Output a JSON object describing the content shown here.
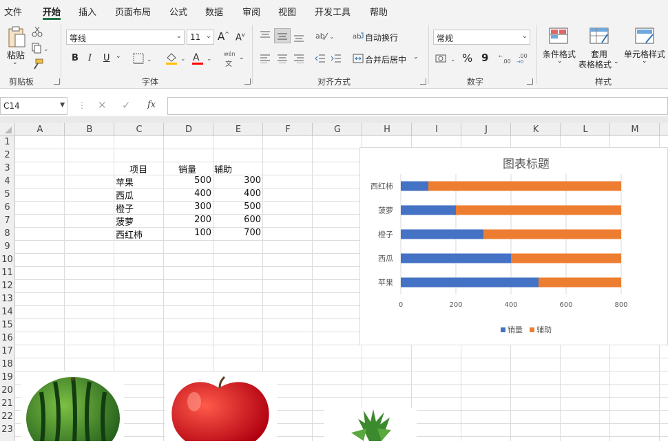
{
  "menu": {
    "items": [
      "文件",
      "开始",
      "插入",
      "页面布局",
      "公式",
      "数据",
      "审阅",
      "视图",
      "开发工具",
      "帮助"
    ]
  },
  "ribbon": {
    "clipboard": {
      "paste": "粘贴",
      "group": "剪贴板"
    },
    "font": {
      "name": "等线",
      "size": "11",
      "group": "字体",
      "bold": "B",
      "italic": "I",
      "underline": "U",
      "phonetic_top": "wén",
      "phonetic_bottom": "文"
    },
    "alignment": {
      "wrap": "自动换行",
      "merge": "合并后居中",
      "group": "对齐方式"
    },
    "number": {
      "format": "常规",
      "percent": "%",
      "comma": "9",
      "group": "数字"
    },
    "styles": {
      "conditional": "条件格式",
      "table_top": "套用",
      "table_bottom": "表格格式",
      "cell_styles": "单元格样式",
      "group": "样式"
    }
  },
  "formula_bar": {
    "name_box": "C14",
    "value": ""
  },
  "columns": [
    "A",
    "B",
    "C",
    "D",
    "E",
    "F",
    "G",
    "H",
    "I",
    "J",
    "K",
    "L",
    "M"
  ],
  "rows": [
    "1",
    "2",
    "3",
    "4",
    "5",
    "6",
    "7",
    "8",
    "9",
    "10",
    "11",
    "12",
    "13",
    "14",
    "15",
    "16",
    "17",
    "18",
    "19",
    "20",
    "21",
    "22",
    "23"
  ],
  "table": {
    "headers": [
      "项目",
      "销量",
      "辅助"
    ],
    "rows": [
      [
        "苹果",
        "500",
        "300"
      ],
      [
        "西瓜",
        "400",
        "400"
      ],
      [
        "橙子",
        "300",
        "500"
      ],
      [
        "菠萝",
        "200",
        "600"
      ],
      [
        "西红柿",
        "100",
        "700"
      ]
    ]
  },
  "chart_data": {
    "type": "bar",
    "stacked": true,
    "orientation": "horizontal",
    "title": "图表标题",
    "categories": [
      "西红柿",
      "菠萝",
      "橙子",
      "西瓜",
      "苹果"
    ],
    "series": [
      {
        "name": "销量",
        "values": [
          100,
          200,
          300,
          400,
          500
        ],
        "color": "#4472c4"
      },
      {
        "name": "辅助",
        "values": [
          700,
          600,
          500,
          400,
          300
        ],
        "color": "#ed7d31"
      }
    ],
    "xlim": [
      0,
      800
    ],
    "xticks": [
      "0",
      "200",
      "400",
      "600",
      "800"
    ],
    "legend": "bottom",
    "grid": true
  }
}
